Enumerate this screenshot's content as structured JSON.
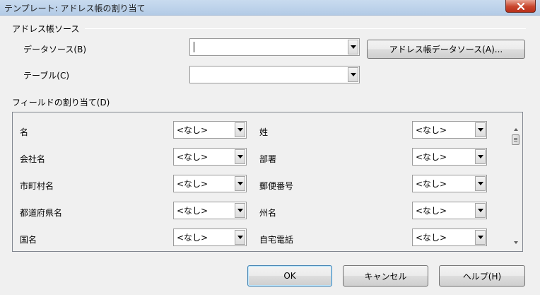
{
  "window": {
    "title": "テンプレート: アドレス帳の割り当て"
  },
  "source_section": {
    "heading": "アドレス帳ソース",
    "datasource_label": "データソース(B)",
    "datasource_value": "",
    "table_label": "テーブル(C)",
    "table_value": "",
    "datasource_button": "アドレス帳データソース(A)..."
  },
  "field_section": {
    "heading": "フィールドの割り当て(D)",
    "rows": [
      {
        "left_label": "名",
        "left_value": "<なし>",
        "right_label": "姓",
        "right_value": "<なし>"
      },
      {
        "left_label": "会社名",
        "left_value": "<なし>",
        "right_label": "部署",
        "right_value": "<なし>"
      },
      {
        "left_label": "市町村名",
        "left_value": "<なし>",
        "right_label": "郵便番号",
        "right_value": "<なし>"
      },
      {
        "left_label": "都道府県名",
        "left_value": "<なし>",
        "right_label": "州名",
        "right_value": "<なし>"
      },
      {
        "left_label": "国名",
        "left_value": "<なし>",
        "right_label": "自宅電話",
        "right_value": "<なし>"
      }
    ]
  },
  "buttons": {
    "ok": "OK",
    "cancel": "キャンセル",
    "help": "ヘルプ(H)"
  }
}
